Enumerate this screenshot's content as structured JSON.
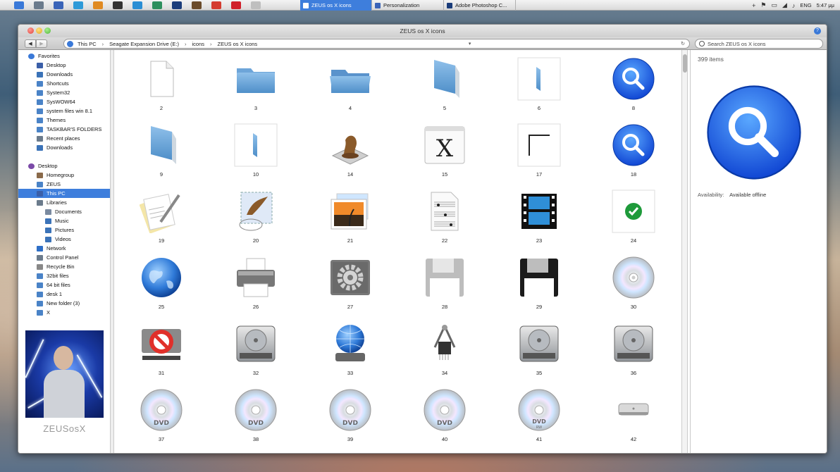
{
  "taskbar": {
    "pinned_icons": [
      {
        "name": "windows-start-icon",
        "color": "#3a79d8"
      },
      {
        "name": "computer-icon",
        "color": "#6b7b8c"
      },
      {
        "name": "monitor-icon",
        "color": "#3a64b8"
      },
      {
        "name": "ie-icon",
        "color": "#2e9ad8"
      },
      {
        "name": "firefox-icon",
        "color": "#e08a22"
      },
      {
        "name": "camera-icon",
        "color": "#333333"
      },
      {
        "name": "skype-icon",
        "color": "#2a8ed4"
      },
      {
        "name": "photos-icon",
        "color": "#2d8f5d"
      },
      {
        "name": "photoshop-icon",
        "color": "#1a3c7a"
      },
      {
        "name": "media-icon",
        "color": "#6a4b2a"
      },
      {
        "name": "chrome-icon",
        "color": "#d43c30"
      },
      {
        "name": "opera-icon",
        "color": "#d0202a"
      },
      {
        "name": "paint-icon",
        "color": "#bfbfbf"
      }
    ],
    "tasks": [
      {
        "label": "ZEUS os X  icons",
        "active": true,
        "icon": "folder-icon",
        "color": "#ffffff"
      },
      {
        "label": "Personalization",
        "active": false,
        "icon": "personalization-icon",
        "color": "#3a64b8"
      },
      {
        "label": "Adobe Photoshop C...",
        "active": false,
        "icon": "photoshop-icon",
        "color": "#1a3c7a"
      }
    ],
    "tray": {
      "plus": "+",
      "language": "ENG",
      "time": "5:47 μμ"
    }
  },
  "window": {
    "title": "ZEUS os X  icons",
    "nav": {
      "back": "◀",
      "forward": "▶"
    },
    "breadcrumb": [
      "This PC",
      "Seagate Expansion Drive (E:)",
      "icons",
      "ZEUS os X  icons"
    ],
    "breadcrumb_sep": "›",
    "search_placeholder": "Search ZEUS os X  icons"
  },
  "sidebar": {
    "favorites": {
      "label": "Favorites",
      "items": [
        {
          "label": "Desktop",
          "icon": "desktop-icon",
          "color": "#3b5fa8"
        },
        {
          "label": "Downloads",
          "icon": "downloads-icon",
          "color": "#3b73b8"
        },
        {
          "label": "Shortcuts",
          "icon": "folder-icon",
          "color": "#4a83c7"
        },
        {
          "label": "System32",
          "icon": "folder-icon",
          "color": "#4a83c7"
        },
        {
          "label": "SysWOW64",
          "icon": "folder-icon",
          "color": "#4a83c7"
        },
        {
          "label": "system files win 8.1",
          "icon": "folder-icon",
          "color": "#4a83c7"
        },
        {
          "label": "Themes",
          "icon": "folder-icon",
          "color": "#4a83c7"
        },
        {
          "label": "TASKBAR'S FOLDERS",
          "icon": "folder-icon",
          "color": "#4a83c7"
        },
        {
          "label": "Recent places",
          "icon": "recent-icon",
          "color": "#6b7b8c"
        },
        {
          "label": "Downloads",
          "icon": "downloads-icon",
          "color": "#3b73b8"
        }
      ]
    },
    "desktop": {
      "label": "Desktop",
      "items": [
        {
          "label": "Homegroup",
          "icon": "homegroup-icon",
          "color": "#8a6a4a",
          "indent": 1
        },
        {
          "label": "ZEUS",
          "icon": "user-folder-icon",
          "color": "#4a83c7",
          "indent": 1
        },
        {
          "label": "This PC",
          "icon": "computer-icon",
          "color": "#3b5fa8",
          "indent": 1,
          "selected": true
        },
        {
          "label": "Libraries",
          "icon": "libraries-icon",
          "color": "#6b7b8c",
          "indent": 1
        },
        {
          "label": "Documents",
          "icon": "documents-icon",
          "color": "#7a8aa0",
          "indent": 2
        },
        {
          "label": "Music",
          "icon": "music-icon",
          "color": "#3b73b8",
          "indent": 2
        },
        {
          "label": "Pictures",
          "icon": "pictures-icon",
          "color": "#3b73b8",
          "indent": 2
        },
        {
          "label": "Videos",
          "icon": "videos-icon",
          "color": "#3b73b8",
          "indent": 2
        },
        {
          "label": "Network",
          "icon": "network-icon",
          "color": "#2e6fc7",
          "indent": 1
        },
        {
          "label": "Control Panel",
          "icon": "control-panel-icon",
          "color": "#6b7b8c",
          "indent": 1
        },
        {
          "label": "Recycle Bin",
          "icon": "recycle-bin-icon",
          "color": "#888888",
          "indent": 1
        },
        {
          "label": "32bit files",
          "icon": "folder-icon",
          "color": "#4a83c7",
          "indent": 1
        },
        {
          "label": "64 bit files",
          "icon": "folder-icon",
          "color": "#4a83c7",
          "indent": 1
        },
        {
          "label": "desk 1",
          "icon": "folder-icon",
          "color": "#4a83c7",
          "indent": 1
        },
        {
          "label": "New folder (3)",
          "icon": "folder-icon",
          "color": "#4a83c7",
          "indent": 1
        },
        {
          "label": "X",
          "icon": "folder-icon",
          "color": "#4a83c7",
          "indent": 1
        }
      ]
    },
    "signature": "ZEUSosX"
  },
  "files": [
    {
      "label": "2",
      "icon": "blank-document-icon"
    },
    {
      "label": "3",
      "icon": "folder-icon"
    },
    {
      "label": "4",
      "icon": "folder-open-icon"
    },
    {
      "label": "5",
      "icon": "folder-side-icon"
    },
    {
      "label": "6",
      "icon": "folder-edge-icon"
    },
    {
      "label": "8",
      "icon": "spotlight-icon"
    },
    {
      "label": "9",
      "icon": "folder-side-icon"
    },
    {
      "label": "10",
      "icon": "folder-edge-icon"
    },
    {
      "label": "14",
      "icon": "chess-icon"
    },
    {
      "label": "15",
      "icon": "x11-icon"
    },
    {
      "label": "17",
      "icon": "corner-icon"
    },
    {
      "label": "18",
      "icon": "spotlight-icon"
    },
    {
      "label": "19",
      "icon": "textedit-icon"
    },
    {
      "label": "20",
      "icon": "mail-stamp-icon"
    },
    {
      "label": "21",
      "icon": "photos-icon"
    },
    {
      "label": "22",
      "icon": "sheet-music-icon"
    },
    {
      "label": "23",
      "icon": "filmstrip-icon"
    },
    {
      "label": "24",
      "icon": "checkmark-icon"
    },
    {
      "label": "25",
      "icon": "globe-icon"
    },
    {
      "label": "26",
      "icon": "printer-icon"
    },
    {
      "label": "27",
      "icon": "gear-icon"
    },
    {
      "label": "28",
      "icon": "floppy-gray-icon"
    },
    {
      "label": "29",
      "icon": "floppy-black-icon"
    },
    {
      "label": "30",
      "icon": "cd-icon"
    },
    {
      "label": "31",
      "icon": "network-forbidden-icon"
    },
    {
      "label": "32",
      "icon": "hard-drive-icon"
    },
    {
      "label": "33",
      "icon": "network-globe-icon"
    },
    {
      "label": "34",
      "icon": "system-profiler-icon"
    },
    {
      "label": "35",
      "icon": "hard-drive-icon"
    },
    {
      "label": "36",
      "icon": "hard-drive-icon"
    },
    {
      "label": "37",
      "icon": "dvd-icon"
    },
    {
      "label": "38",
      "icon": "dvd-icon"
    },
    {
      "label": "39",
      "icon": "dvd-icon"
    },
    {
      "label": "40",
      "icon": "dvd-icon"
    },
    {
      "label": "41",
      "icon": "dvd-rw-icon"
    },
    {
      "label": "42",
      "icon": "mac-mini-icon"
    }
  ],
  "preview": {
    "count": "399 items",
    "icon": "spotlight-icon",
    "availability_label": "Availability:",
    "availability_value": "Available offline"
  }
}
